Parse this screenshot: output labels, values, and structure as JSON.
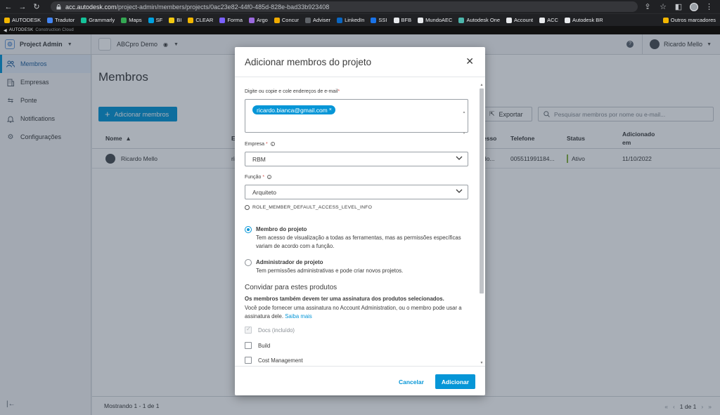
{
  "browser": {
    "url_host": "acc.autodesk.com",
    "url_path": "/project-admin/members/projects/0ac23e82-44f0-485d-828e-bad33b923408",
    "bookmarks": [
      {
        "label": "AUTODESK",
        "color": "#f2b600"
      },
      {
        "label": "Tradutor",
        "color": "#4285f4"
      },
      {
        "label": "Grammarly",
        "color": "#15c39a"
      },
      {
        "label": "Maps",
        "color": "#34a853"
      },
      {
        "label": "SF",
        "color": "#00a1e0"
      },
      {
        "label": "BI",
        "color": "#f2c811"
      },
      {
        "label": "CLEAR",
        "color": "#f2b600"
      },
      {
        "label": "Forma",
        "color": "#7b61ff"
      },
      {
        "label": "Argo",
        "color": "#9c6ade"
      },
      {
        "label": "Concur",
        "color": "#f0ab00"
      },
      {
        "label": "Adviser",
        "color": "#5f6368"
      },
      {
        "label": "LinkedIn",
        "color": "#0a66c2"
      },
      {
        "label": "SSI",
        "color": "#1a73e8"
      },
      {
        "label": "BFB",
        "color": "#e8eaed"
      },
      {
        "label": "MundoAEC",
        "color": "#e8eaed"
      },
      {
        "label": "Autodesk One",
        "color": "#4db6ac"
      },
      {
        "label": "Account",
        "color": "#e8eaed"
      },
      {
        "label": "ACC",
        "color": "#e8eaed"
      },
      {
        "label": "Autodesk BR",
        "color": "#e8eaed"
      }
    ],
    "other_bookmarks": "Outros marcadores"
  },
  "autodesk_bar": {
    "brand": "AUTODESK",
    "product": "Construction Cloud"
  },
  "header": {
    "module": "Project Admin",
    "project": "ABCpro Demo",
    "user": "Ricardo Mello"
  },
  "sidebar": {
    "items": [
      {
        "label": "Membros",
        "icon": "people-icon",
        "active": true
      },
      {
        "label": "Empresas",
        "icon": "building-icon",
        "active": false
      },
      {
        "label": "Ponte",
        "icon": "bridge-icon",
        "active": false
      },
      {
        "label": "Notifications",
        "icon": "bell-icon",
        "active": false
      },
      {
        "label": "Configurações",
        "icon": "gear-icon",
        "active": false
      }
    ]
  },
  "main": {
    "title": "Membros",
    "add_button": "Adicionar membros",
    "export_button": "Exportar",
    "search_placeholder": "Pesquisar membros por nome ou e-mail...",
    "columns": {
      "name": "Nome",
      "email": "E",
      "access": "esso",
      "phone": "Telefone",
      "status": "Status",
      "added_line1": "Adicionado",
      "added_line2": "em"
    },
    "rows": [
      {
        "name": "Ricardo Mello",
        "email": "ri",
        "access": "do...",
        "phone": "005511991184...",
        "status": "Ativo",
        "added": "11/10/2022"
      }
    ],
    "footer_text": "Mostrando 1 - 1 de 1",
    "pager_label": "1 de 1"
  },
  "modal": {
    "title": "Adicionar membros do projeto",
    "email_label": "Digite ou copie e cole endereços de e-mail",
    "email_chip": "ricardo.bianca@gmail.com",
    "company_label": "Empresa",
    "company_value": "RBM",
    "role_label": "Função",
    "role_value": "Arquiteto",
    "role_info": "ROLE_MEMBER_DEFAULT_ACCESS_LEVEL_INFO",
    "options": [
      {
        "title": "Membro do projeto",
        "desc": "Tem acesso de visualização a todas as ferramentas, mas as permissões específicas variam de acordo com a função.",
        "selected": true
      },
      {
        "title": "Administrador de projeto",
        "desc": "Tem permissões administrativas e pode criar novos projetos.",
        "selected": false
      }
    ],
    "products_title": "Convidar para estes produtos",
    "products_bold": "Os membros também devem ter uma assinatura dos produtos selecionados.",
    "products_desc": "Você pode fornecer uma assinatura no Account Administration, ou o membro pode usar a assinatura dele.",
    "products_link": "Saiba mais",
    "products": [
      {
        "label": "Docs (incluído)",
        "checked": true,
        "disabled": true
      },
      {
        "label": "Build",
        "checked": false,
        "disabled": false
      },
      {
        "label": "Cost Management",
        "checked": false,
        "disabled": false
      }
    ],
    "cancel": "Cancelar",
    "submit": "Adicionar"
  }
}
